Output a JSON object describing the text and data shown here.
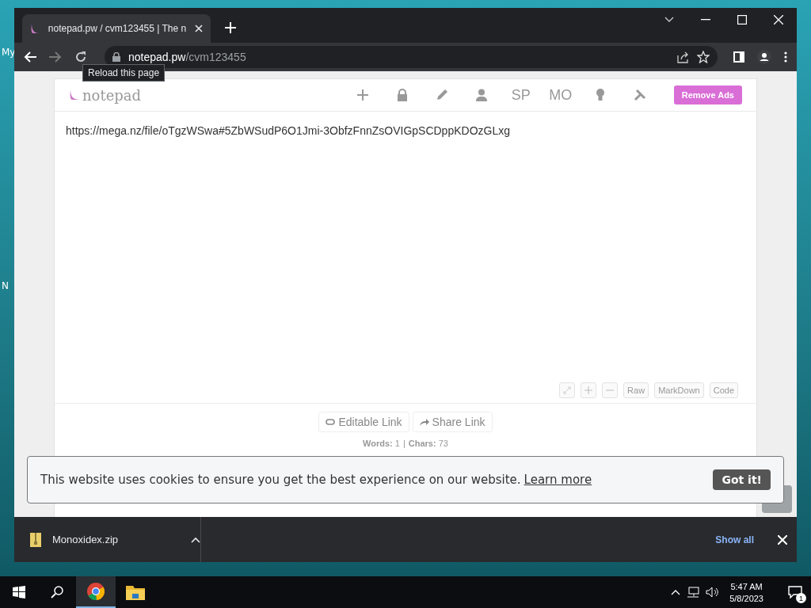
{
  "desktop": {
    "icon_labels": [
      "My",
      "N"
    ]
  },
  "browser": {
    "tab": {
      "title": "notepad.pw / cvm123455 | The n",
      "selected": true
    },
    "address": {
      "host": "notepad.pw",
      "path": "/cvm123455"
    },
    "tooltip": "Reload this page"
  },
  "notepad": {
    "logo": "notepad",
    "nav_text": [
      "SP",
      "MO"
    ],
    "remove_ads": "Remove Ads",
    "content": "https://mega.nz/file/oTgzWSwa#5ZbWSudP6O1Jmi-3ObfzFnnZsOVIGpSCDppKDOzGLxg",
    "editor_buttons": [
      "Raw",
      "MarkDown",
      "Code"
    ],
    "links": [
      "Editable Link",
      "Share Link"
    ],
    "stats": [
      {
        "label": "Words:",
        "value": "1"
      },
      {
        "label": "Chars:",
        "value": "73"
      }
    ],
    "separator": "|"
  },
  "cookie": {
    "message": "This website uses cookies to ensure you get the best experience on our website.",
    "link": "Learn more",
    "button": "Got it!"
  },
  "downloads": {
    "file": "Monoxidex.zip",
    "show_all": "Show all"
  },
  "taskbar": {
    "apps": [
      {
        "kind": "browser",
        "selected": true
      },
      {
        "kind": "folder",
        "selected": false
      }
    ],
    "time": "5:47 AM",
    "date": "5/8/2023",
    "notifications": "1"
  }
}
